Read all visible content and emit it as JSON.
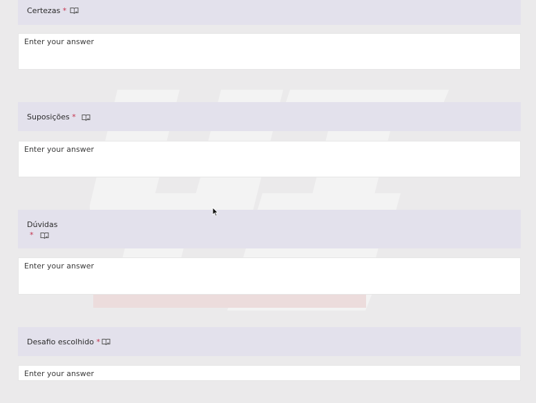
{
  "required_mark": "*",
  "questions": [
    {
      "label": "Certezas",
      "answer_placeholder": "Enter your answer"
    },
    {
      "label": "Suposições",
      "answer_placeholder": "Enter your answer"
    },
    {
      "label": "Dúvidas",
      "answer_placeholder": "Enter your answer"
    },
    {
      "label": "Desafio escolhido",
      "answer_placeholder": "Enter your answer"
    }
  ],
  "colors": {
    "header_bg": "#e3e1ec",
    "required": "#c4314b",
    "page_bg": "#ebeaeb"
  },
  "icons": [
    "immersive-reader-icon",
    "mouse-cursor-icon"
  ]
}
